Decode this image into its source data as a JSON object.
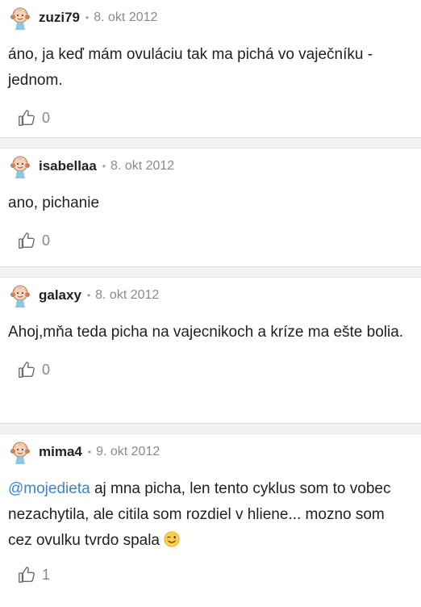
{
  "comments": [
    {
      "user": "zuzi79",
      "sep": "•",
      "date": "8. okt 2012",
      "text": "áno, ja keď mám ovuláciu tak ma pichá vo vaječníku - jednom.",
      "likes": "0"
    },
    {
      "user": "isabellaa",
      "sep": "•",
      "date": "8. okt 2012",
      "text": "ano, pichanie",
      "likes": "0"
    },
    {
      "user": "galaxy",
      "sep": "•",
      "date": "8. okt 2012",
      "text": "Ahoj,mňa teda picha na vajecnikoch a kríze ma ešte bolia.",
      "likes": "0"
    },
    {
      "user": "mima4",
      "sep": "•",
      "date": "9. okt 2012",
      "mention": "@mojedieta",
      "text": " aj mna picha, len tento cyklus som to vobec nezachytila, ale citila som rozdiel v hliene... mozno som cez ovulku tvrdo spala",
      "likes": "1"
    }
  ],
  "icons": {
    "avatar": "cartoon-girl-avatar-icon",
    "like": "thumbs-up-icon",
    "emoji": "winking-face-icon"
  },
  "colors": {
    "mention": "#3a86c8",
    "separator": "#f1f1f1",
    "date": "#8a8a8a"
  }
}
